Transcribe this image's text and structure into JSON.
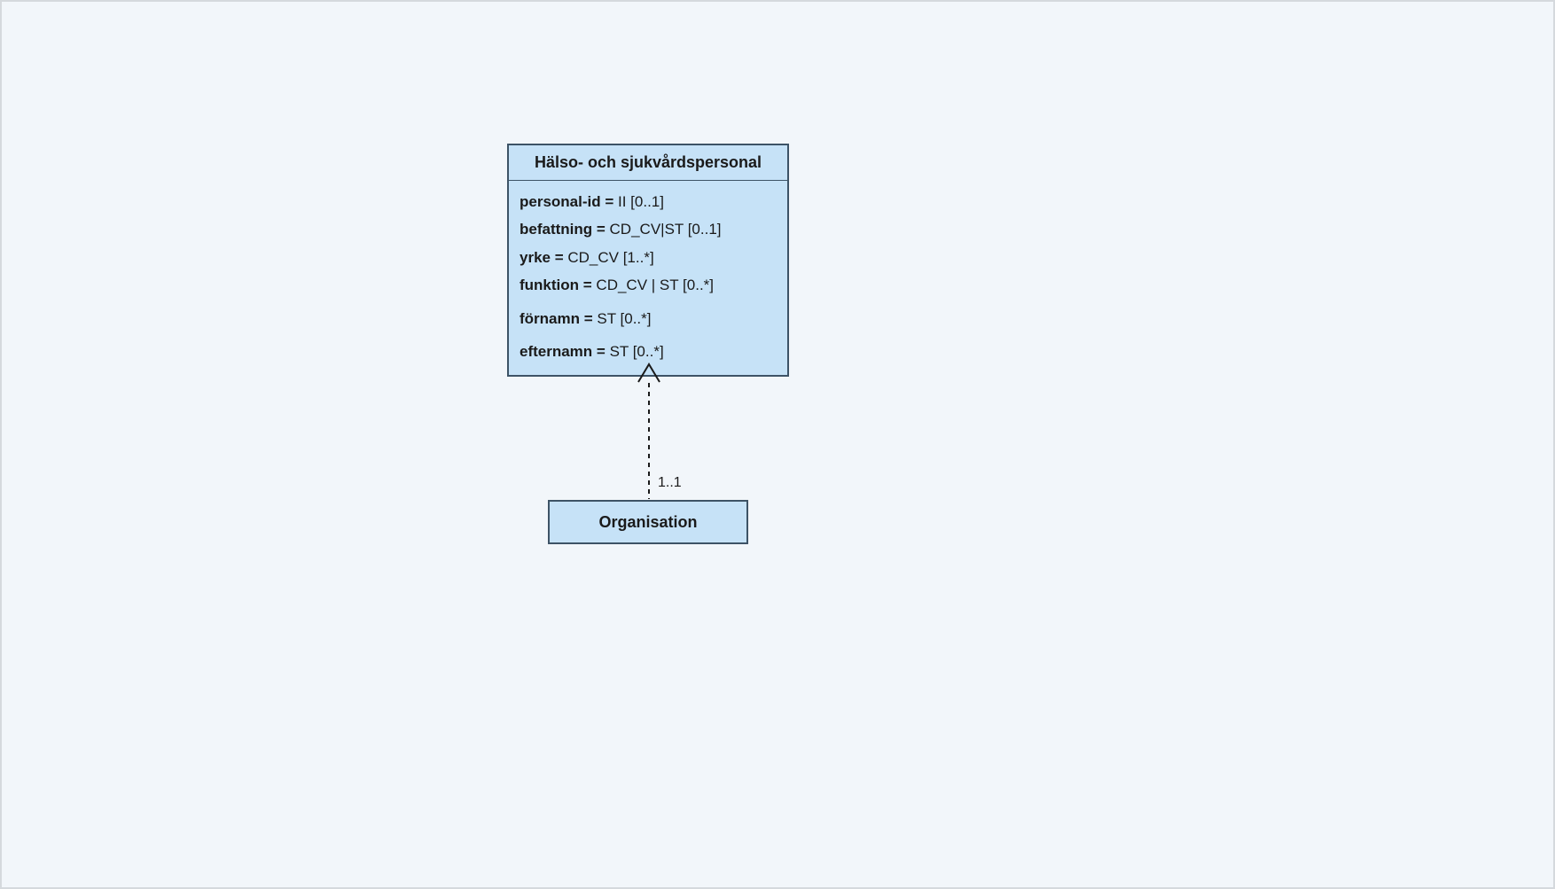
{
  "class1": {
    "title": "Hälso- och sjukvårdspersonal",
    "attrs": [
      {
        "name": "personal-id  =",
        "value": " II [0..1]"
      },
      {
        "name": "befattning = ",
        "value": " CD_CV|ST [0..1]"
      },
      {
        "name": "yrke =",
        "value": " CD_CV [1..*]"
      },
      {
        "name": "funktion = ",
        "value": " CD_CV | ST [0..*]"
      },
      {
        "name": "förnamn = ",
        "value": " ST [0..*]"
      },
      {
        "name": "efternamn =",
        "value": " ST [0..*]"
      }
    ]
  },
  "class2": {
    "title": "Organisation"
  },
  "association": {
    "multiplicity": "1..1"
  }
}
